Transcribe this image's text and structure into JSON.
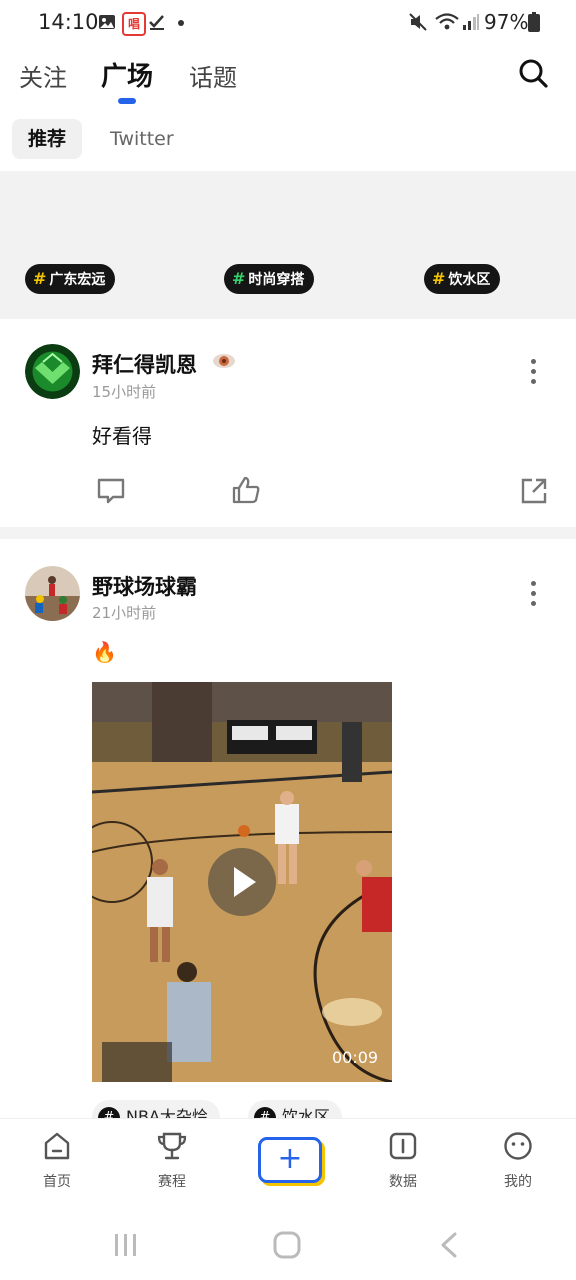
{
  "status_bar": {
    "time": "14:10",
    "icons_left": [
      "image-icon",
      "app-badge-icon",
      "check-icon",
      "dot-icon"
    ],
    "battery": "97%",
    "badge_text": "唱"
  },
  "header": {
    "tabs": [
      {
        "label": "关注",
        "active": false
      },
      {
        "label": "广场",
        "active": true
      },
      {
        "label": "话题",
        "active": false
      }
    ],
    "accent_color": "#2563eb"
  },
  "sub_tabs": [
    {
      "label": "推荐",
      "active": true
    },
    {
      "label": "Twitter",
      "active": false
    }
  ],
  "banner_tags": [
    {
      "label": "广东宏远"
    },
    {
      "label": "时尚穿搭"
    },
    {
      "label": "饮水区"
    }
  ],
  "posts": [
    {
      "author": "拜仁得凯恩",
      "time": "15小时前",
      "text": "好看得"
    },
    {
      "author": "野球场球霸",
      "time": "21小时前",
      "text": "🔥",
      "video_duration": "00:09",
      "tags": [
        {
          "label": "NBA大杂烩"
        },
        {
          "label": "饮水区"
        }
      ]
    }
  ],
  "bottom_nav": [
    {
      "label": "首页",
      "icon": "home-icon"
    },
    {
      "label": "赛程",
      "icon": "trophy-icon"
    },
    {
      "label": "",
      "icon": "plus-icon"
    },
    {
      "label": "数据",
      "icon": "data-icon"
    },
    {
      "label": "我的",
      "icon": "profile-icon"
    }
  ]
}
